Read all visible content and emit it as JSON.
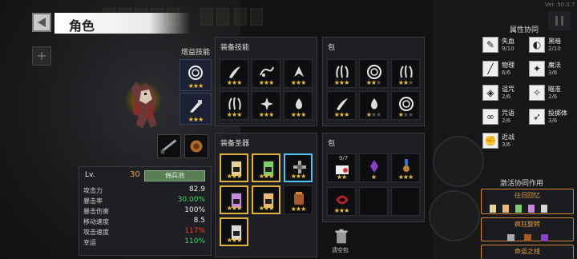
{
  "version": "Ver. 50.0.7",
  "title": "角色",
  "sections": {
    "boost_skills": "增益技能",
    "equip_skills": "装备技能",
    "bag1": "包",
    "equip_relics": "装备圣器",
    "bag2": "包",
    "synergy_title": "属性协同",
    "active_synergy_title": "激活协同作用"
  },
  "relic_count": "9/7",
  "clear_bag": "清空包",
  "level": {
    "label": "Lv.",
    "value": "30",
    "detail_button": "佣兵池"
  },
  "stats": [
    {
      "name": "攻击力",
      "value": "82.9",
      "color": "normal"
    },
    {
      "name": "暴击率",
      "value": "30.00%",
      "color": "green"
    },
    {
      "name": "暴击伤害",
      "value": "100%",
      "color": "normal"
    },
    {
      "name": "移动速度",
      "value": "8.5",
      "color": "normal"
    },
    {
      "name": "攻击速度",
      "value": "117%",
      "color": "red"
    },
    {
      "name": "幸运",
      "value": "110%",
      "color": "green"
    }
  ],
  "synergies": [
    {
      "name": "失血",
      "count": "9/10",
      "icon": "blood-drop-icon"
    },
    {
      "name": "黑暗",
      "count": "2/10",
      "icon": "dark-swirl-icon"
    },
    {
      "name": "物理",
      "count": "6/6",
      "icon": "sword-icon"
    },
    {
      "name": "魔法",
      "count": "3/6",
      "icon": "magic-star-icon"
    },
    {
      "name": "诅咒",
      "count": "2/6",
      "icon": "curse-eye-icon"
    },
    {
      "name": "瞄准",
      "count": "2/6",
      "icon": "target-icon"
    },
    {
      "name": "咒语",
      "count": "2/6",
      "icon": "spell-chain-icon"
    },
    {
      "name": "投掷体",
      "count": "3/6",
      "icon": "projectile-icon"
    },
    {
      "name": "近战",
      "count": "3/6",
      "icon": "fist-icon"
    }
  ],
  "active_synergies": [
    {
      "name": "往日回忆"
    },
    {
      "name": "疯狂旋转"
    },
    {
      "name": "命运之线"
    }
  ],
  "colors": {
    "gold": "#e1b33a",
    "star": "#f2c230",
    "green": "#3ed36a",
    "red": "#ff3b30",
    "orange": "#f0a340"
  }
}
